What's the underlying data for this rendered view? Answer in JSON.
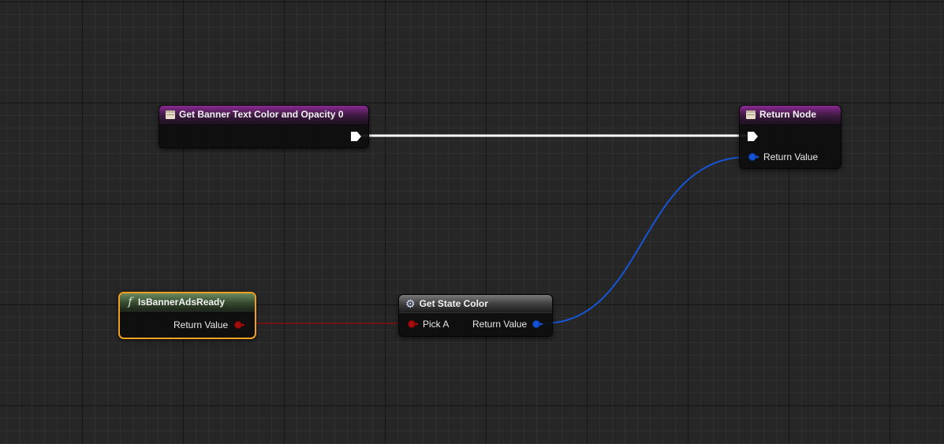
{
  "nodes": {
    "entry": {
      "title": "Get Banner Text Color and Opacity 0",
      "icon": "function-entry-icon"
    },
    "return": {
      "title": "Return Node",
      "icon": "function-return-icon",
      "return_label": "Return Value"
    },
    "is_ready": {
      "title": "IsBannerAdsReady",
      "icon": "function-icon",
      "return_label": "Return Value",
      "selected": true
    },
    "state_color": {
      "title": "Get State Color",
      "icon": "gear-icon",
      "input_label": "Pick A",
      "return_label": "Return Value"
    }
  },
  "colors": {
    "exec_wire": "#ffffff",
    "struct_pin": "#1453d8",
    "bool_pin": "#a30d0d",
    "selection": "#f0a020",
    "function_entry_header": "#8a2a92",
    "pure_function_header": "#6b8c5e"
  }
}
